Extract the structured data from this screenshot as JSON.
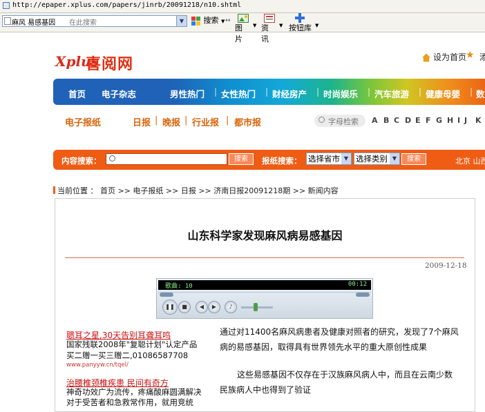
{
  "browser": {
    "url": "http://epaper.xplus.com/papers/jinrb/20091218/n10.shtml",
    "search_value": "麻风  易感基因",
    "search_placeholder": "在此搜索",
    "search_btn": "搜索",
    "images_btn": "图片",
    "news_btn": "资讯",
    "buttons_btn": "按钮库"
  },
  "site": {
    "logo_x": "Xplus",
    "logo_text": "喜阅网",
    "set_home": "设为首页",
    "fav": "添"
  },
  "nav": [
    "首页",
    "电子杂志",
    "男性热门",
    "女性热门",
    "财经房产",
    "时尚娱乐",
    "汽车旅游",
    "健康母婴",
    "数"
  ],
  "paper_row": {
    "title": "电子报纸",
    "links": [
      "日报",
      "晚报",
      "行业报",
      "都市报"
    ],
    "letter_search": "字母检索",
    "letters": [
      "A",
      "B",
      "C",
      "D",
      "E",
      "F",
      "G",
      "H",
      "I",
      "J",
      "K"
    ]
  },
  "search_band": {
    "content_label": "内容搜索：",
    "content_value": "",
    "btn": "搜索",
    "paper_label": "报纸搜索：",
    "province": "选择省市",
    "category": "选择类别",
    "cities": "北京  山西"
  },
  "breadcrumb": "当前位置 ： 首页 >> 电子报纸 >> 日报 >> 济南日报20091218期 >> 新闻内容",
  "article": {
    "title": "山东科学家发现麻风病易感基因",
    "date": "2009-12-18",
    "p1_line1": "通过对11400名麻风病患者及健康对照者的研究，发现了7个麻风",
    "p1_line2": "病的易感基因，取得具有世界领先水平的重大原创性成果",
    "p2_line1": "这些易感基因不仅存在于汉族麻风病人中，而且在云南少数",
    "p2_line2": "民族病人中也得到了验证"
  },
  "player": {
    "song_label": "歌曲: 10",
    "time": "00:12",
    "volume_level": 0.45
  },
  "ads": [
    {
      "title": "聩耳之星,30天告别耳聋耳鸣",
      "line1": "国家残联2008年\"复聪计划\"认定产品",
      "line2": "买二赠一买三赠二,01086587708",
      "url": "www.panyyw.cn/tqel/"
    },
    {
      "title": "治腰椎颈椎疾患 民间有奇方",
      "line1": "神奇功效广为流传，疼痛酸麻圆满解决",
      "line2": "对于受苦者和急救常作用，就用竞统"
    }
  ],
  "colors": {
    "orange": "#ef5c14",
    "nav_blue": "#1f62b8",
    "link_orange": "#d8650c",
    "ad_red": "#cc1111"
  }
}
